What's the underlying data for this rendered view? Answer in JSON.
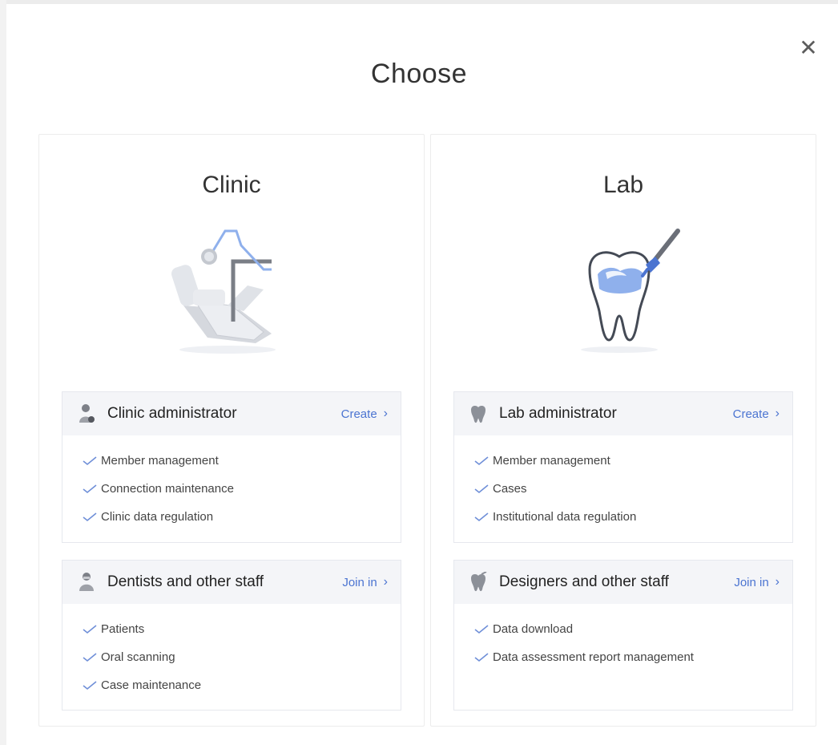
{
  "dialog": {
    "title": "Choose",
    "close_glyph": "✕"
  },
  "clinic": {
    "title": "Clinic",
    "illustration": "dental-chair-illustration",
    "roles": [
      {
        "name": "Clinic administrator",
        "icon": "administrator-icon",
        "action": "Create",
        "features": [
          "Member management",
          "Connection maintenance",
          "Clinic data regulation"
        ]
      },
      {
        "name": "Dentists and other staff",
        "icon": "dentist-icon",
        "action": "Join in",
        "features": [
          "Patients",
          "Oral scanning",
          "Case maintenance"
        ]
      }
    ]
  },
  "lab": {
    "title": "Lab",
    "illustration": "tooth-brush-illustration",
    "roles": [
      {
        "name": "Lab administrator",
        "icon": "tooth-icon",
        "action": "Create",
        "features": [
          "Member management",
          "Cases",
          "Institutional data regulation"
        ]
      },
      {
        "name": "Designers and other staff",
        "icon": "tooth-icon",
        "action": "Join in",
        "features": [
          "Data download",
          "Data assessment report management"
        ]
      }
    ]
  },
  "colors": {
    "accent": "#4b74d1",
    "check": "#6f8fd8",
    "header_bg": "#f4f5f8"
  }
}
